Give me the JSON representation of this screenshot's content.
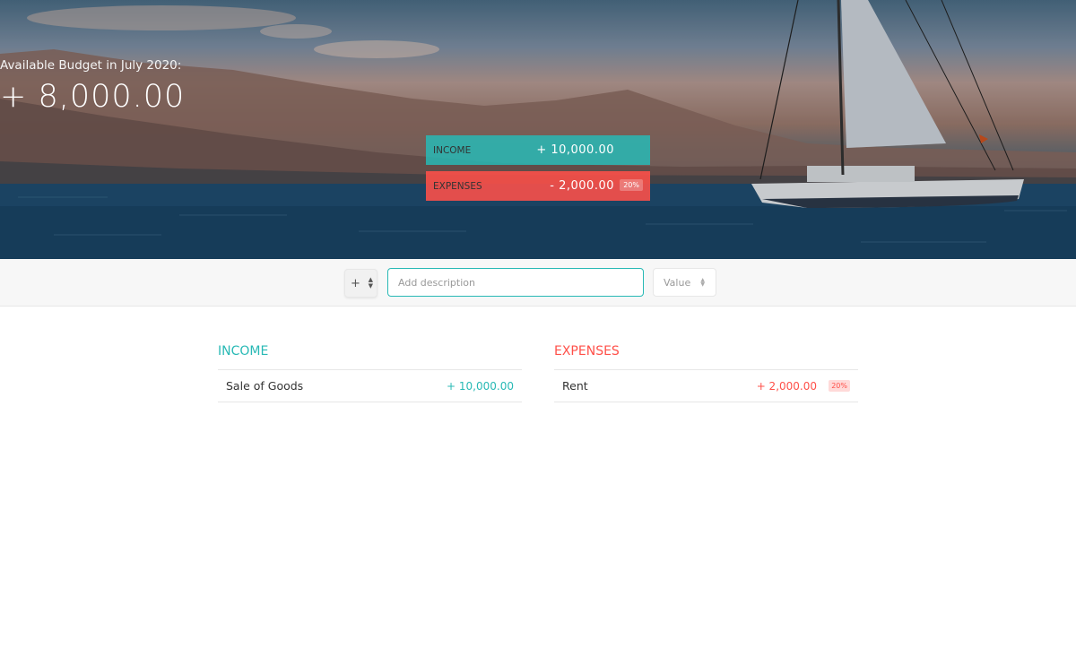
{
  "budget": {
    "title": "Available Budget in July 2020:",
    "value": "+ 8,000.00"
  },
  "summary": {
    "income_label": "Income",
    "income_value": "+ 10,000.00",
    "expenses_label": "Expenses",
    "expenses_value": "- 2,000.00",
    "expenses_percentage": "20%"
  },
  "add_bar": {
    "type_value": "+",
    "description_placeholder": "Add description",
    "value_placeholder": "Value"
  },
  "income": {
    "title": "Income",
    "items": [
      {
        "description": "Sale of Goods",
        "value": "+ 10,000.00"
      }
    ]
  },
  "expenses": {
    "title": "Expenses",
    "items": [
      {
        "description": "Rent",
        "value": "+ 2,000.00",
        "percentage": "20%"
      }
    ]
  },
  "colors": {
    "income": "#28b9b5",
    "expenses": "#ff5049"
  },
  "icons": {
    "type_select_arrows": "up-down-arrows-icon",
    "value_spinner": "spinner-arrows-icon",
    "hero_image": "sailboat-sea-photo"
  }
}
